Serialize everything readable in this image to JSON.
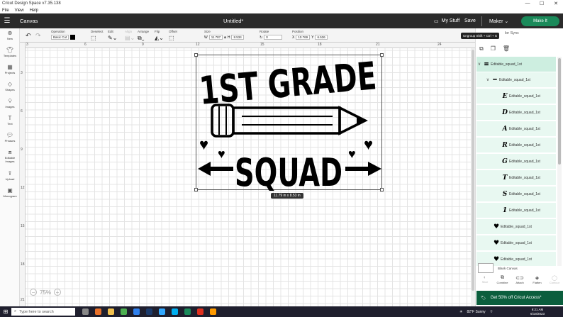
{
  "window": {
    "title": "Cricut Design Space  v7.35.138",
    "controls": [
      "—",
      "☐",
      "✕"
    ]
  },
  "menu": [
    "File",
    "View",
    "Help"
  ],
  "appbar": {
    "section": "Canvas",
    "doc_title": "Untitled*",
    "my_stuff": "My Stuff",
    "save": "Save",
    "machine": "Maker",
    "make_it": "Make It"
  },
  "toolbar": {
    "operation": {
      "label": "Operation",
      "value": "Basic Cut"
    },
    "deselect": "Deselect",
    "edit": "Edit",
    "align": "Align",
    "arrange": "Arrange",
    "flip": "Flip",
    "offset": "Offset",
    "size": {
      "label": "Size",
      "w_label": "W",
      "w": "11.787",
      "h_label": "H",
      "h": "8.534"
    },
    "rotate": {
      "label": "Rotate",
      "value": "0"
    },
    "position": {
      "label": "Position",
      "x_label": "X",
      "x": "10.769",
      "y_label": "Y",
      "y": "6.536"
    },
    "accent": "#000000"
  },
  "nav": [
    {
      "label": "New",
      "icon": "plus-icon"
    },
    {
      "label": "Templates",
      "icon": "shirt-icon"
    },
    {
      "label": "Projects",
      "icon": "projects-icon"
    },
    {
      "label": "Shapes",
      "icon": "shapes-icon"
    },
    {
      "label": "Images",
      "icon": "images-icon"
    },
    {
      "label": "Text",
      "icon": "text-icon"
    },
    {
      "label": "Phrases",
      "icon": "phrases-icon"
    },
    {
      "label": "Editable Images",
      "icon": "editable-icon"
    },
    {
      "label": "Upload",
      "icon": "upload-icon"
    },
    {
      "label": "Monogram",
      "icon": "monogram-icon"
    }
  ],
  "ruler": {
    "top": [
      "3",
      "6",
      "9",
      "12",
      "15",
      "18",
      "21",
      "24"
    ],
    "left": [
      "3",
      "6",
      "9",
      "12",
      "15",
      "18",
      "21"
    ]
  },
  "design": {
    "line1": "1ST GRADE",
    "line2": "SQUAD",
    "dimensions": "11.79  in x 8.53  in"
  },
  "zoom": {
    "value": "75%",
    "minus": "−",
    "plus": "+"
  },
  "tooltip": "Ungroup Shift + Ctrl + G",
  "color_sync": "lor Sync",
  "layers": [
    {
      "name": "Editable_squad_1st",
      "glyph": "≡",
      "indent": 0,
      "expand": "∨"
    },
    {
      "name": "Editable_squad_1st",
      "glyph": "━",
      "indent": 1,
      "expand": "∨"
    },
    {
      "name": "Editable_squad_1st",
      "glyph": "E",
      "indent": 2,
      "expand": ""
    },
    {
      "name": "Editable_squad_1st",
      "glyph": "D",
      "indent": 2,
      "expand": ""
    },
    {
      "name": "Editable_squad_1st",
      "glyph": "A",
      "indent": 2,
      "expand": ""
    },
    {
      "name": "Editable_squad_1st",
      "glyph": "R",
      "indent": 2,
      "expand": ""
    },
    {
      "name": "Editable_squad_1st",
      "glyph": "G",
      "indent": 2,
      "expand": ""
    },
    {
      "name": "Editable_squad_1st",
      "glyph": "T",
      "indent": 2,
      "expand": ""
    },
    {
      "name": "Editable_squad_1st",
      "glyph": "S",
      "indent": 2,
      "expand": ""
    },
    {
      "name": "Editable_squad_1st",
      "glyph": "1",
      "indent": 2,
      "expand": ""
    },
    {
      "name": "Editable_squad_1st",
      "glyph": "♥",
      "indent": 1,
      "expand": ""
    },
    {
      "name": "Editable_squad_1st",
      "glyph": "♥",
      "indent": 1,
      "expand": ""
    },
    {
      "name": "Editable_squad_1st",
      "glyph": "♥",
      "indent": 1,
      "expand": ""
    }
  ],
  "blank_canvas": "Blank Canvas",
  "actions": [
    "Slice",
    "Combine",
    "Attach",
    "Flatten",
    "Contour"
  ],
  "promo": "Get 50% off Cricut Access*",
  "taskbar": {
    "search": "Type here to search",
    "weather": "82°F  Sunny",
    "time": "9:21 AM",
    "date": "6/19/2023"
  }
}
